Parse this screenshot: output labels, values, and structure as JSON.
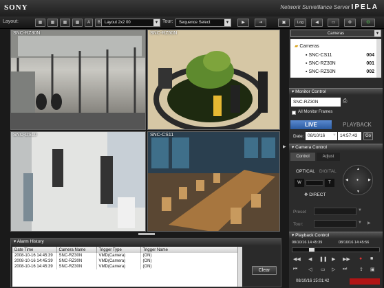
{
  "brand": {
    "logo": "SONY",
    "product": "Network Surveillance Server",
    "product_mark": "IPELA"
  },
  "toolbar": {
    "layout_label": "Layout:",
    "layout_buttons": [
      "A",
      "B"
    ],
    "layout_select": "Layout 2x2 00",
    "tour_label": "Tour:",
    "tour_select": "Sequence Select",
    "log_label": "Log"
  },
  "cameras": [
    {
      "name": "SNC-RZ30N"
    },
    {
      "name": "SNC-RZ50N"
    },
    {
      "name": "SNC-DS10"
    },
    {
      "name": "SNC-CS11"
    }
  ],
  "alarm": {
    "title": "Alarm History",
    "columns": [
      "Date Time",
      "Camera Name",
      "Trigger Type",
      "Trigger Name"
    ],
    "rows": [
      [
        "2008-10-16 14:45:39",
        "SNC-RZ30N",
        "VMD(Camera)",
        "(ON)"
      ],
      [
        "2008-10-16 14:45:39",
        "SNC-RZ30N",
        "VMD(Camera)",
        "(ON)"
      ],
      [
        "2008-10-16 14:45:39",
        "SNC-RZ30N",
        "VMD(Camera)",
        "(ON)"
      ]
    ],
    "clear_label": "Clear"
  },
  "right": {
    "cameras_select": "Cameras",
    "tree_root": "Cameras",
    "tree_items": [
      {
        "name": "SNC-CS11",
        "num": "004"
      },
      {
        "name": "SNC-RZ30N",
        "num": "001"
      },
      {
        "name": "SNC-RZ50N",
        "num": "002"
      }
    ],
    "monitor_control": "Monitor Control",
    "monitor_camera": "SNC-RZ30N",
    "all_frames": "All Monitor Frames",
    "live": "LIVE",
    "playback": "PLAYBACK",
    "date_label": "Date:",
    "date_value": "08/10/16",
    "time_value": "14:57:43",
    "go": "Go",
    "camera_control": "Camera Control",
    "tab_control": "Control",
    "tab_adjust": "Adjust",
    "optical": "OPTICAL",
    "digital": "DIGITAL",
    "zoom_w": "W",
    "zoom_t": "T",
    "direct": "DIRECT",
    "preset": "Preset",
    "tour": "Tour:",
    "playback_control": "Playback Control",
    "pb_start": "08/10/16 14:45:39",
    "pb_end": "08/10/16 14:45:56",
    "status_time": "08/10/16 15:01:42"
  }
}
